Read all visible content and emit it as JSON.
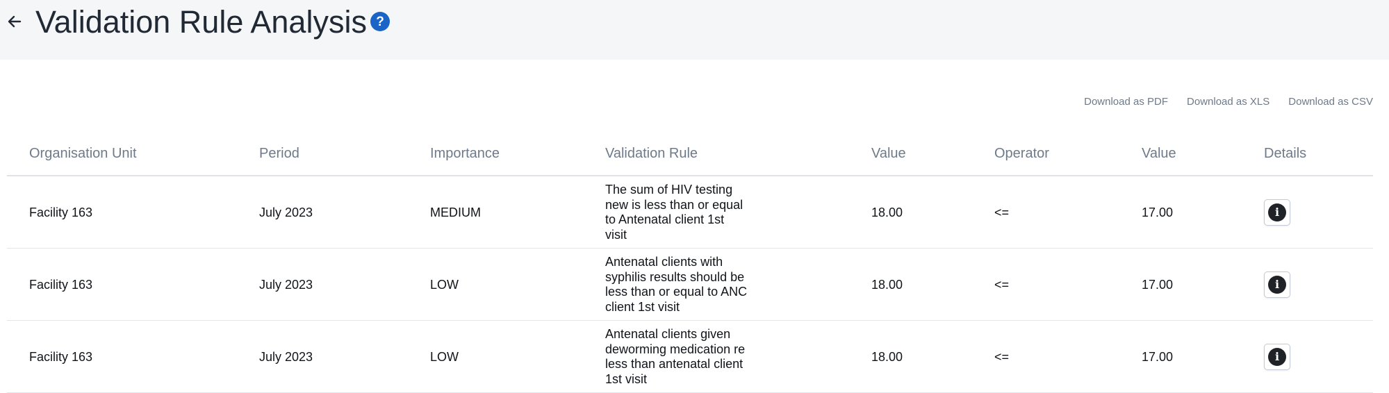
{
  "header": {
    "title": "Validation Rule Analysis",
    "back_icon": "arrow-left-icon",
    "help_icon": "question-circle-icon",
    "help_glyph": "?",
    "accent_color": "#1a63c7",
    "background_color": "#f5f6f8"
  },
  "downloads": {
    "pdf": "Download as PDF",
    "xls": "Download as XLS",
    "csv": "Download as CSV"
  },
  "table": {
    "columns": {
      "org_unit": "Organisation Unit",
      "period": "Period",
      "importance": "Importance",
      "rule": "Validation Rule",
      "left_value": "Value",
      "operator": "Operator",
      "right_value": "Value",
      "details": "Details"
    },
    "rows": [
      {
        "org_unit": "Facility 163",
        "period": "July 2023",
        "importance": "MEDIUM",
        "rule": "The sum of HIV testing new is less than or equal to Antenatal client 1st visit",
        "left_value": "18.00",
        "operator": "<=",
        "right_value": "17.00",
        "details_icon": "info-circle-icon"
      },
      {
        "org_unit": "Facility 163",
        "period": "July 2023",
        "importance": "LOW",
        "rule": "Antenatal clients with syphilis results should be less than or equal to ANC client 1st visit",
        "left_value": "18.00",
        "operator": "<=",
        "right_value": "17.00",
        "details_icon": "info-circle-icon"
      },
      {
        "org_unit": "Facility 163",
        "period": "July 2023",
        "importance": "LOW",
        "rule": "Antenatal clients given deworming medication re less than antenatal client 1st visit",
        "left_value": "18.00",
        "operator": "<=",
        "right_value": "17.00",
        "details_icon": "info-circle-icon"
      }
    ]
  }
}
